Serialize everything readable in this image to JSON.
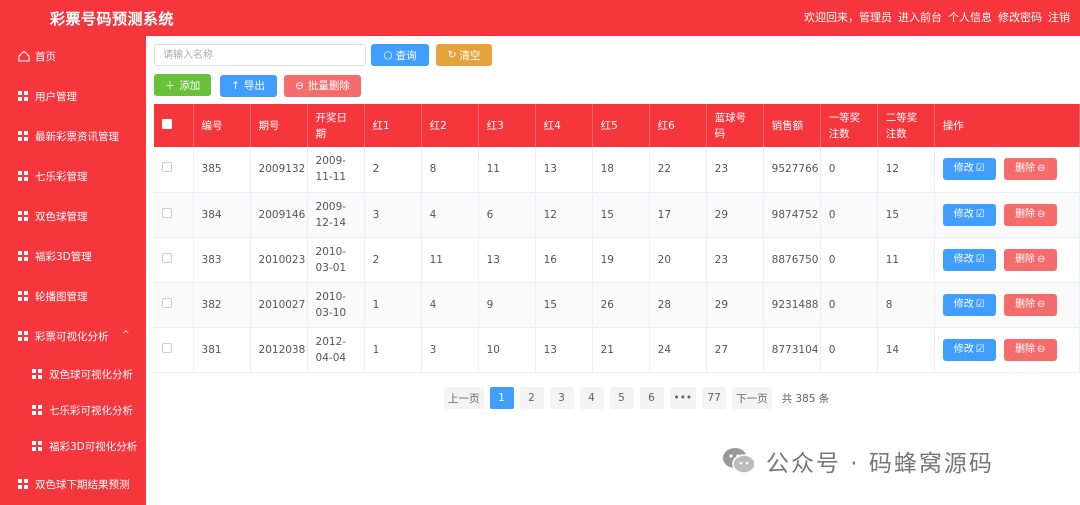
{
  "header": {
    "title": "彩票号码预测系统",
    "welcome": "欢迎回来，管理员",
    "links": [
      "进入前台",
      "个人信息",
      "修改密码",
      "注销"
    ]
  },
  "sidebar": {
    "home": "首页",
    "items": [
      "用户管理",
      "最新彩票资讯管理",
      "七乐彩管理",
      "双色球管理",
      "福彩3D管理",
      "轮播图管理"
    ],
    "group": "彩票可视化分析",
    "group_sub": [
      "双色球可视化分析",
      "七乐彩可视化分析",
      "福彩3D可视化分析"
    ],
    "last": "双色球下期结果预测"
  },
  "toolbar": {
    "search_placeholder": "请输入名称",
    "query": "查询",
    "clear": "清空",
    "add": "添加",
    "export": "导出",
    "batch_delete": "批量删除"
  },
  "table": {
    "headers": [
      "编号",
      "期号",
      "开奖日期",
      "红1",
      "红2",
      "红3",
      "红4",
      "红5",
      "红6",
      "蓝球号码",
      "销售额",
      "一等奖注数",
      "二等奖注数",
      "操作"
    ],
    "rows": [
      [
        "385",
        "2009132",
        "2009-11-11",
        "2",
        "8",
        "11",
        "13",
        "18",
        "22",
        "23",
        "9527766",
        "0",
        "12"
      ],
      [
        "384",
        "2009146",
        "2009-12-14",
        "3",
        "4",
        "6",
        "12",
        "15",
        "17",
        "29",
        "9874752",
        "0",
        "15"
      ],
      [
        "383",
        "2010023",
        "2010-03-01",
        "2",
        "11",
        "13",
        "16",
        "19",
        "20",
        "23",
        "8876750",
        "0",
        "11"
      ],
      [
        "382",
        "2010027",
        "2010-03-10",
        "1",
        "4",
        "9",
        "15",
        "26",
        "28",
        "29",
        "9231488",
        "0",
        "8"
      ],
      [
        "381",
        "2012038",
        "2012-04-04",
        "1",
        "3",
        "10",
        "13",
        "21",
        "24",
        "27",
        "8773104",
        "0",
        "14"
      ]
    ],
    "edit_label": "修改",
    "delete_label": "删除"
  },
  "pagination": {
    "prev": "上一页",
    "pages": [
      "1",
      "2",
      "3",
      "4",
      "5",
      "6",
      "•••",
      "77"
    ],
    "active": "1",
    "next": "下一页",
    "total": "共 385 条"
  },
  "watermark": "公众号 · 码蜂窝源码",
  "colors": {
    "primary_red": "#f5363c",
    "blue": "#409eff",
    "orange": "#e6a23c",
    "green": "#67c23a",
    "pink": "#f56c6c"
  }
}
